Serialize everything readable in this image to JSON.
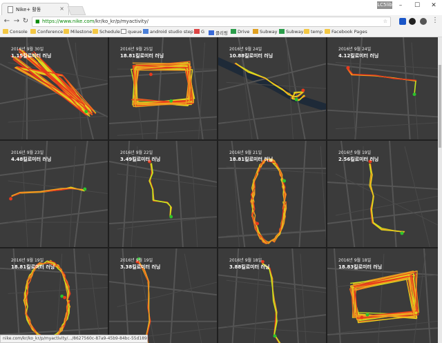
{
  "browser": {
    "tab_title": "Nike+ 활동",
    "tab_close": "×",
    "profile": "LC5lib",
    "win_minimize": "–",
    "win_maximize": "☐",
    "win_close": "✕",
    "back": "←",
    "forward": "→",
    "reload": "↻",
    "url_host": "https://www.nike.com",
    "url_path": "/kr/ko_kr/p/myactivity/",
    "lock": "🔒",
    "bookmark_star": "☆",
    "menu": "⋮"
  },
  "bookmarks": [
    {
      "label": "Console",
      "type": "folder"
    },
    {
      "label": "Conference",
      "type": "folder"
    },
    {
      "label": "Milestone",
      "type": "folder"
    },
    {
      "label": "Schedule",
      "type": "folder"
    },
    {
      "label": "queue",
      "type": "page"
    },
    {
      "label": "android studio step",
      "type": "page"
    },
    {
      "label": "G",
      "type": "gmail"
    },
    {
      "label": "클리핑",
      "type": "page"
    },
    {
      "label": "Drive",
      "type": "drive"
    },
    {
      "label": "Subway",
      "type": "page"
    },
    {
      "label": "Subway",
      "type": "page"
    },
    {
      "label": "temp",
      "type": "folder"
    },
    {
      "label": "Facebook Pages",
      "type": "folder"
    }
  ],
  "activities": [
    {
      "date": "2016년 9월 30일",
      "distance": "1.15킬로미터 러닝"
    },
    {
      "date": "2016년 9월 25일",
      "distance": "18.81킬로미터 러닝"
    },
    {
      "date": "2016년 9월 24일",
      "distance": "10.88킬로미터 러닝"
    },
    {
      "date": "2016년 9월 24일",
      "distance": "4.12킬로미터 러닝"
    },
    {
      "date": "2016년 9월 23일",
      "distance": "4.48킬로미터 러닝"
    },
    {
      "date": "2016년 9월 22일",
      "distance": "3.49킬로미터 러닝"
    },
    {
      "date": "2016년 9월 21일",
      "distance": "18.81킬로미터 러닝"
    },
    {
      "date": "2016년 9월 19일",
      "distance": "2.56킬로미터 러닝"
    },
    {
      "date": "2016년 9월 19일",
      "distance": "18.81킬로미터 러닝"
    },
    {
      "date": "2016년 9월 19일",
      "distance": "3.38킬로미터 러닝"
    },
    {
      "date": "2016년 9월 18일",
      "distance": "3.88킬로미터 러닝"
    },
    {
      "date": "2016년 9월 18일",
      "distance": "18.83킬로미터 러닝"
    }
  ],
  "status_url": "nike.com/kr/ko_kr/p/myactivity/.../8627560c-87a9-45b9-84bc-55d18904075a",
  "colors": {
    "map_bg": "#3b3b3b",
    "route_hot": "#e8391c",
    "route_mid": "#f0a020",
    "route_cool": "#c6e61e",
    "start": "#2cc22c"
  }
}
